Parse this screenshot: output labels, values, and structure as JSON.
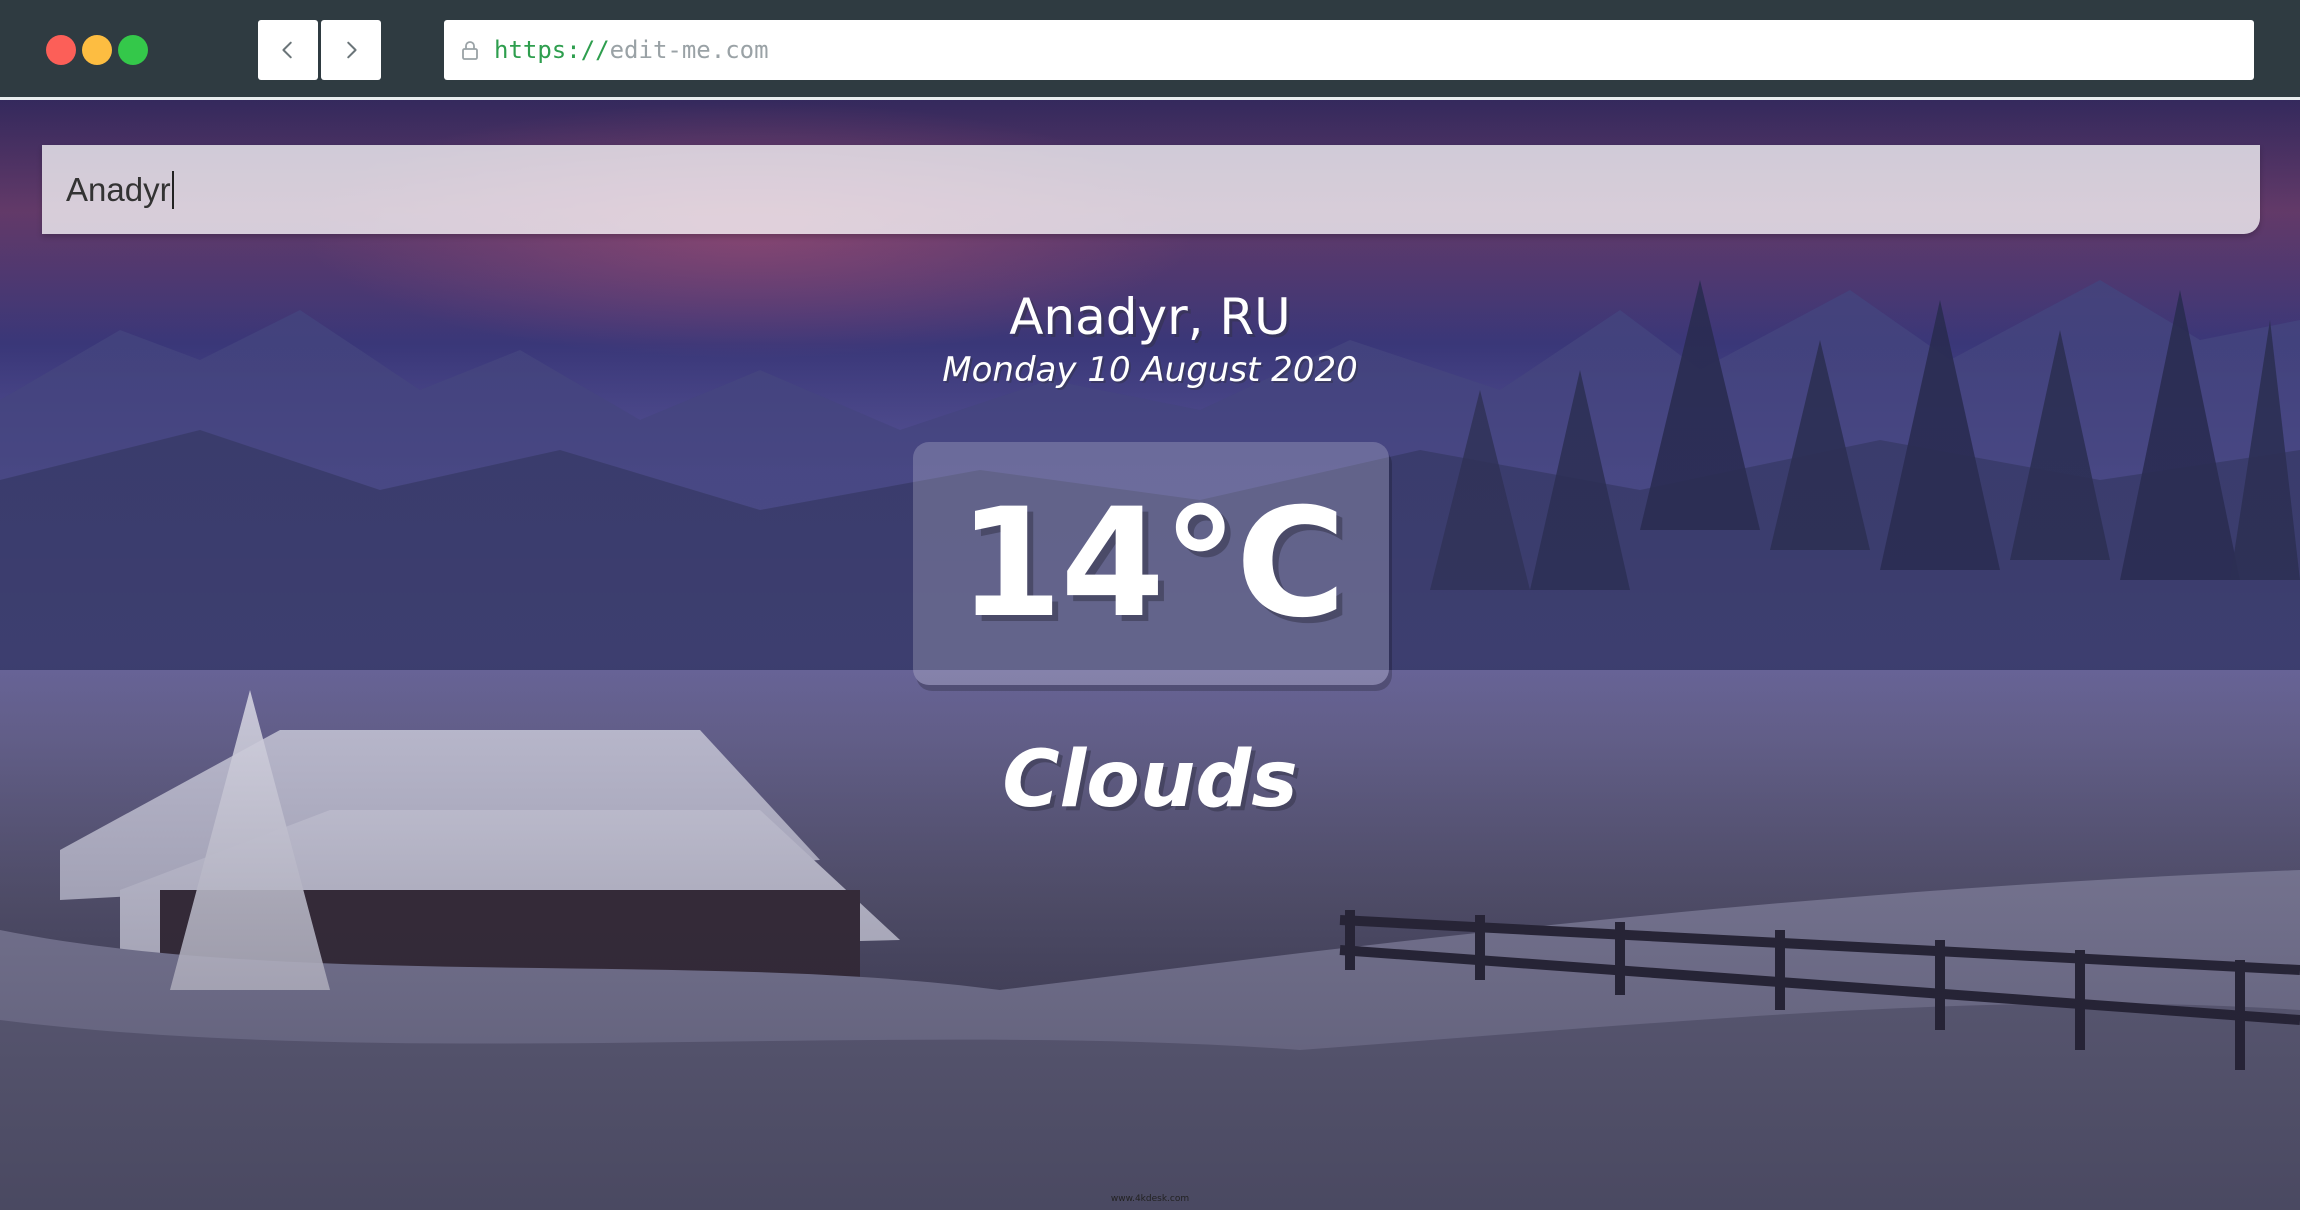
{
  "browser": {
    "url_scheme": "https://",
    "url_host": "edit-me.com"
  },
  "search": {
    "value": "Anadyr"
  },
  "weather": {
    "location": "Anadyr, RU",
    "date": "Monday 10 August 2020",
    "temperature": "14°C",
    "condition": "Clouds"
  },
  "footer": {
    "credit": "www.4kdesk.com"
  },
  "icons": {
    "back": "chevron-left-icon",
    "forward": "chevron-right-icon",
    "lock": "lock-icon"
  },
  "colors": {
    "traffic_red": "#fc5f58",
    "traffic_yellow": "#fdbd41",
    "traffic_green": "#34c84a",
    "url_scheme": "#2e9e4e"
  }
}
